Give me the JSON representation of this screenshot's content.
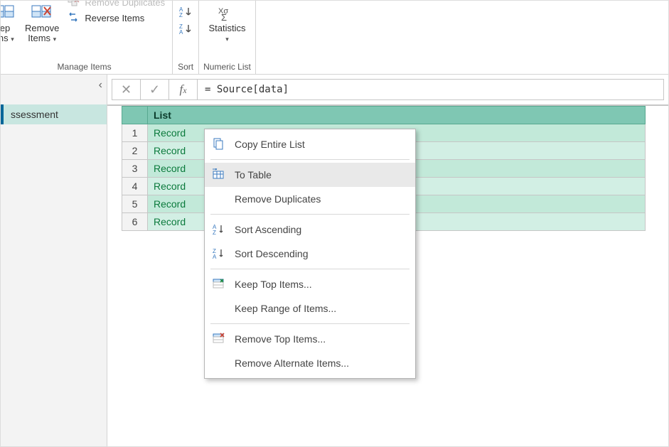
{
  "ribbon": {
    "keep_label_l1": "ep",
    "keep_label_l2": "ms",
    "remove_label_l1": "Remove",
    "remove_label_l2": "Items",
    "remove_dup_label": "Remove Duplicates",
    "reverse_label": "Reverse Items",
    "manage_group": "Manage Items",
    "sort_group": "Sort",
    "stats_label": "Statistics",
    "numlist_group": "Numeric List"
  },
  "left": {
    "query": "ssessment"
  },
  "formula": {
    "text": "= Source[data]"
  },
  "grid": {
    "header": "List",
    "rows": [
      {
        "n": "1",
        "v": "Record"
      },
      {
        "n": "2",
        "v": "Record"
      },
      {
        "n": "3",
        "v": "Record"
      },
      {
        "n": "4",
        "v": "Record"
      },
      {
        "n": "5",
        "v": "Record"
      },
      {
        "n": "6",
        "v": "Record"
      }
    ]
  },
  "menu": {
    "copy": "Copy Entire List",
    "to_table": "To Table",
    "remove_dup": "Remove Duplicates",
    "sort_asc": "Sort Ascending",
    "sort_desc": "Sort Descending",
    "keep_top": "Keep Top Items...",
    "keep_range": "Keep Range of Items...",
    "remove_top": "Remove Top Items...",
    "remove_alt": "Remove Alternate Items..."
  }
}
